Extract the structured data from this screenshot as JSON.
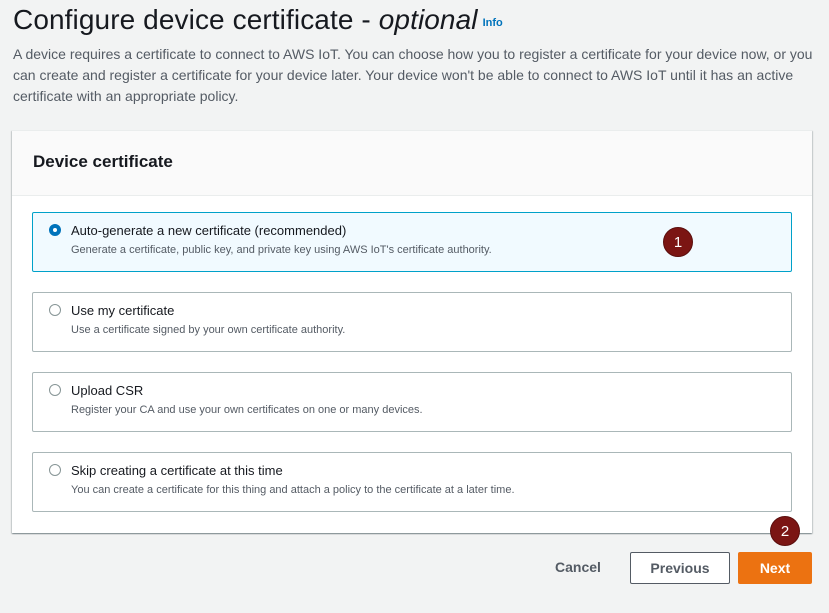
{
  "header": {
    "title": "Configure device certificate - ",
    "title_optional": "optional",
    "info_label": "Info",
    "description": "A device requires a certificate to connect to AWS IoT. You can choose how you to register a certificate for your device now, or you can create and register a certificate for your device later. Your device won't be able to connect to AWS IoT until it has an active certificate with an appropriate policy."
  },
  "panel": {
    "title": "Device certificate",
    "options": [
      {
        "label": "Auto-generate a new certificate (recommended)",
        "description": "Generate a certificate, public key, and private key using AWS IoT's certificate authority.",
        "selected": true
      },
      {
        "label": "Use my certificate",
        "description": "Use a certificate signed by your own certificate authority.",
        "selected": false
      },
      {
        "label": "Upload CSR",
        "description": "Register your CA and use your own certificates on one or many devices.",
        "selected": false
      },
      {
        "label": "Skip creating a certificate at this time",
        "description": "You can create a certificate for this thing and attach a policy to the certificate at a later time.",
        "selected": false
      }
    ]
  },
  "markers": [
    "1",
    "2"
  ],
  "actions": {
    "cancel_label": "Cancel",
    "previous_label": "Previous",
    "next_label": "Next"
  },
  "colors": {
    "accent": "#0073bb",
    "primary_button": "#ec7211",
    "marker": "#7b1513",
    "selected_border": "#00a1c9"
  }
}
